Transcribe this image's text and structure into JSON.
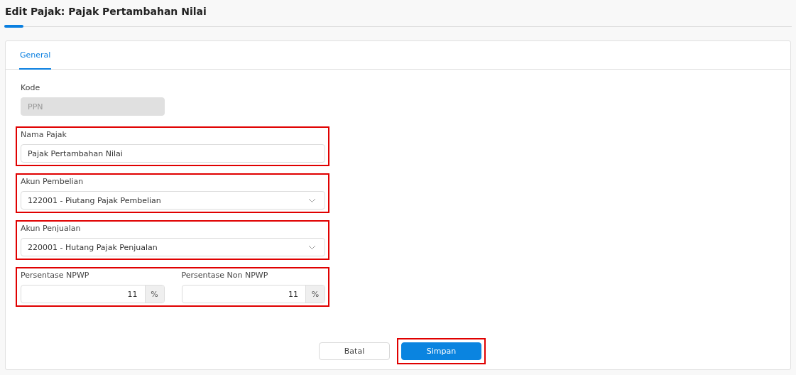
{
  "title": "Edit Pajak: Pajak Pertambahan Nilai",
  "tabs": [
    {
      "label": "General",
      "selected": true
    }
  ],
  "fields": [
    {
      "kind": "text",
      "label": "Kode",
      "value": "PPN",
      "disabled": true,
      "highlighted": false
    },
    {
      "kind": "text",
      "label": "Nama Pajak",
      "value": "Pajak Pertambahan Nilai",
      "disabled": false,
      "highlighted": true
    },
    {
      "kind": "select",
      "label": "Akun Pembelian",
      "value": "122001 - Piutang Pajak Pembelian",
      "disabled": false,
      "highlighted": true
    },
    {
      "kind": "select",
      "label": "Akun Penjualan",
      "value": "220001 - Hutang Pajak Penjualan",
      "disabled": false,
      "highlighted": true
    },
    {
      "kind": "percent_pair",
      "highlighted": true,
      "items": [
        {
          "label": "Persentase NPWP",
          "value": "11",
          "unit": "%"
        },
        {
          "label": "Persentase Non NPWP",
          "value": "11",
          "unit": "%"
        }
      ]
    }
  ],
  "buttons": [
    {
      "label": "Batal",
      "kind": "secondary",
      "highlighted": false
    },
    {
      "label": "Simpan",
      "kind": "primary",
      "highlighted": true
    }
  ]
}
